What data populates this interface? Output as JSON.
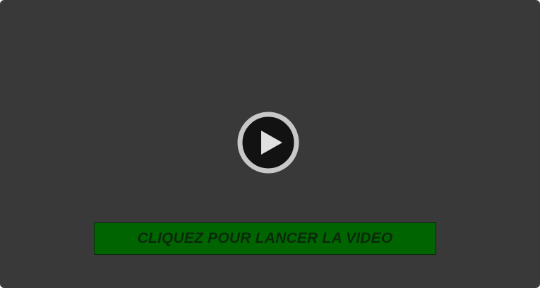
{
  "player": {
    "background_color": "#393939",
    "play_icon": "play-icon",
    "play_ring_color": "#c8c8c8",
    "play_fill_color": "#121212"
  },
  "cta": {
    "label": "CLIQUEZ POUR LANCER LA VIDEO",
    "background_color": "#006400",
    "text_color": "#0a2a0a"
  }
}
